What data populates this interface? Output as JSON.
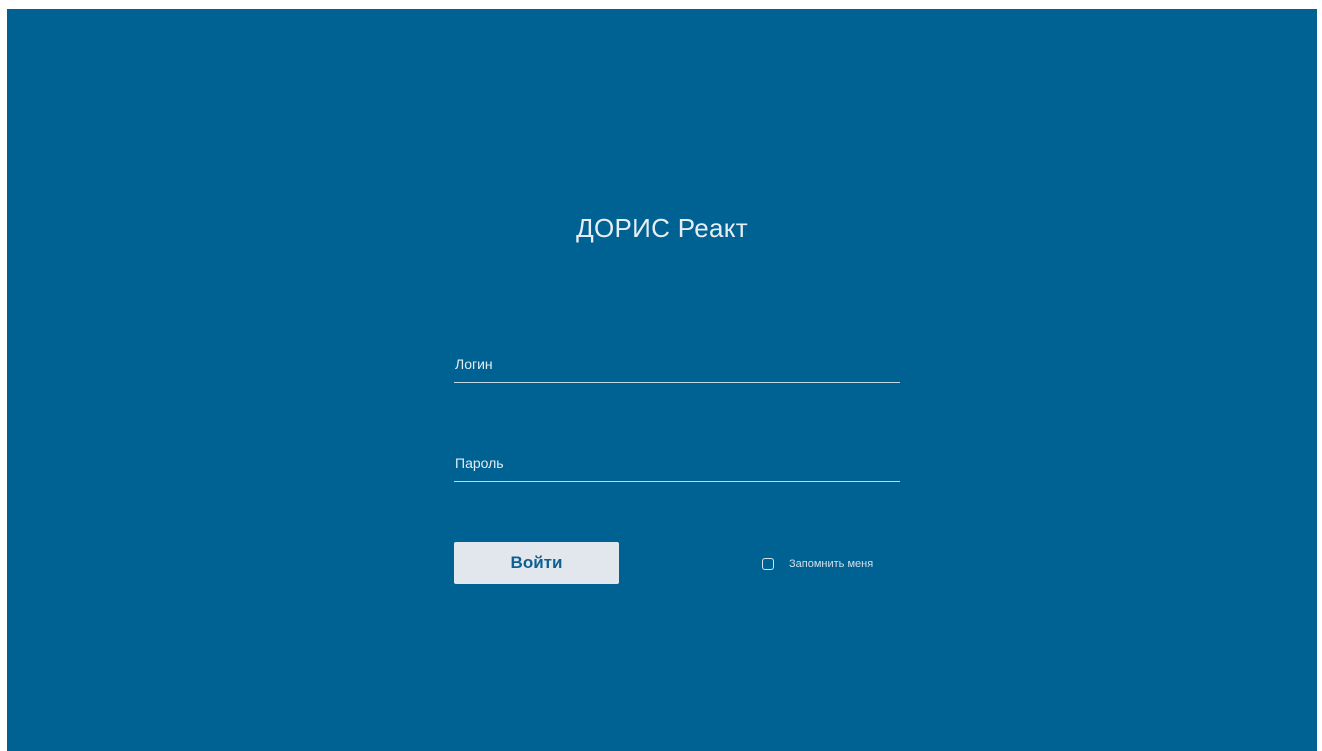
{
  "app": {
    "title": "ДОРИС Реакт"
  },
  "login_form": {
    "login_field": {
      "value": "",
      "placeholder": "Логин"
    },
    "password_field": {
      "value": "",
      "placeholder": "Пароль"
    },
    "submit_label": "Войти",
    "remember_me": {
      "label": "Запомнить меня",
      "checked": false
    }
  },
  "colors": {
    "background": "#006193",
    "button_background": "#e1e7ec",
    "button_text": "#0e5f92",
    "text": "#e6eef4"
  }
}
